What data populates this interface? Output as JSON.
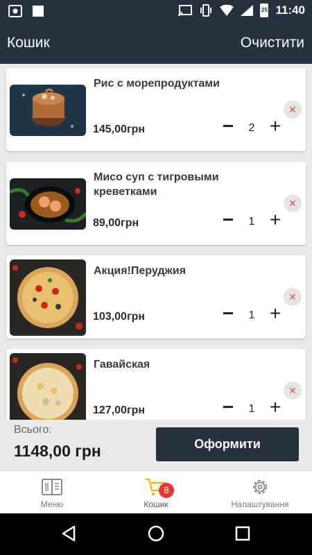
{
  "status_bar": {
    "time": "11:40",
    "battery_level": "25"
  },
  "app_bar": {
    "title": "Кошик",
    "clear_label": "Очистити"
  },
  "cart_items": [
    {
      "name": "Рис с морепродуктами",
      "price": "145,00грн",
      "quantity": "2",
      "minus": "−",
      "plus": "+",
      "remove": "✕",
      "image": "rice-seafood-dish"
    },
    {
      "name": "Мисо суп с тигровыми креветками",
      "price": "89,00грн",
      "quantity": "1",
      "minus": "−",
      "plus": "+",
      "remove": "✕",
      "image": "miso-soup-shrimp"
    },
    {
      "name": "Акция!Перуджия",
      "price": "103,00грн",
      "quantity": "1",
      "minus": "−",
      "plus": "+",
      "remove": "✕",
      "image": "pizza-perugia"
    },
    {
      "name": "Гавайская",
      "price": "127,00грн",
      "quantity": "1",
      "minus": "−",
      "plus": "+",
      "remove": "✕",
      "image": "pizza-hawaiian"
    }
  ],
  "total": {
    "label": "Всього:",
    "value": "1148,00 грн"
  },
  "checkout": {
    "label": "Оформити"
  },
  "tabs": [
    {
      "label": "Меню",
      "icon": "menu-book-icon"
    },
    {
      "label": "Кошик",
      "icon": "cart-icon",
      "badge": "8",
      "active": true
    },
    {
      "label": "Налаштування",
      "icon": "gear-icon"
    }
  ],
  "colors": {
    "primary": "#263140",
    "accent": "#f2b600",
    "badge": "#e53935",
    "remove": "#d9534f"
  }
}
